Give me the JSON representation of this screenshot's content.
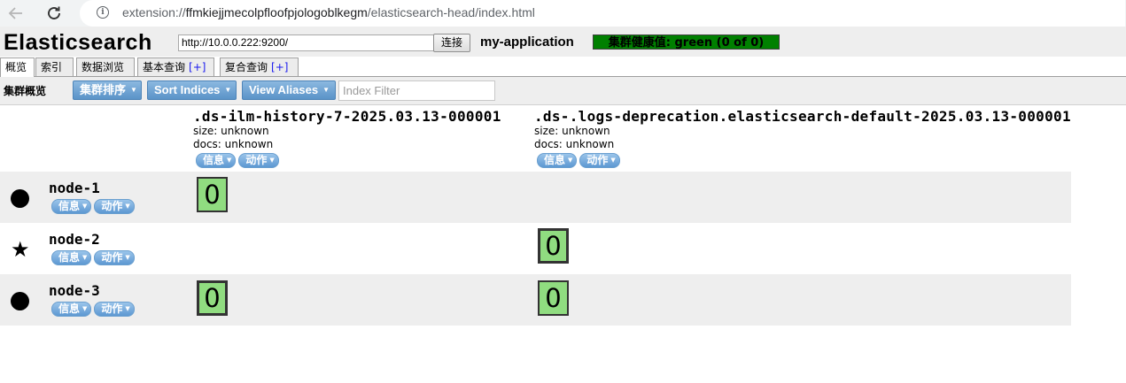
{
  "browser": {
    "url_prefix": "extension://",
    "url_host": "ffmkiejjmecolpfloofpjologoblkegm",
    "url_path": "/elasticsearch-head/index.html"
  },
  "header": {
    "title": "Elasticsearch",
    "connection_url": "http://10.0.0.222:9200/",
    "connect_label": "连接",
    "cluster_name": "my-application",
    "health_text": "集群健康值: green (0 of 0)",
    "health_color": "#008000"
  },
  "tabs": [
    {
      "label": "概览",
      "plus": ""
    },
    {
      "label": "索引",
      "plus": ""
    },
    {
      "label": "数据浏览",
      "plus": ""
    },
    {
      "label": "基本查询",
      "plus": "[+]"
    },
    {
      "label": "复合查询",
      "plus": "[+]"
    }
  ],
  "toolbar": {
    "label": "集群概览",
    "sort_cluster": "集群排序",
    "sort_indices": "Sort Indices",
    "view_aliases": "View Aliases",
    "filter_placeholder": "Index Filter"
  },
  "indices": [
    {
      "name": ".ds-ilm-history-7-2025.03.13-000001",
      "size": "size: unknown",
      "docs": "docs: unknown",
      "info": "信息",
      "action": "动作"
    },
    {
      "name": ".ds-.logs-deprecation.elasticsearch-default-2025.03.13-000001",
      "size": "size: unknown",
      "docs": "docs: unknown",
      "info": "信息",
      "action": "动作"
    }
  ],
  "nodes": [
    {
      "name": "node-1",
      "marker": "dot",
      "info": "信息",
      "action": "动作",
      "shards": [
        "0",
        ""
      ]
    },
    {
      "name": "node-2",
      "marker": "star",
      "info": "信息",
      "action": "动作",
      "shards": [
        "",
        "0"
      ]
    },
    {
      "name": "node-3",
      "marker": "dot",
      "info": "信息",
      "action": "动作",
      "shards": [
        "0",
        "0"
      ]
    }
  ],
  "colors": {
    "shard_fill": "#90dc80",
    "button_blue": "#5a93c8",
    "row_shade": "#eeeeee"
  }
}
